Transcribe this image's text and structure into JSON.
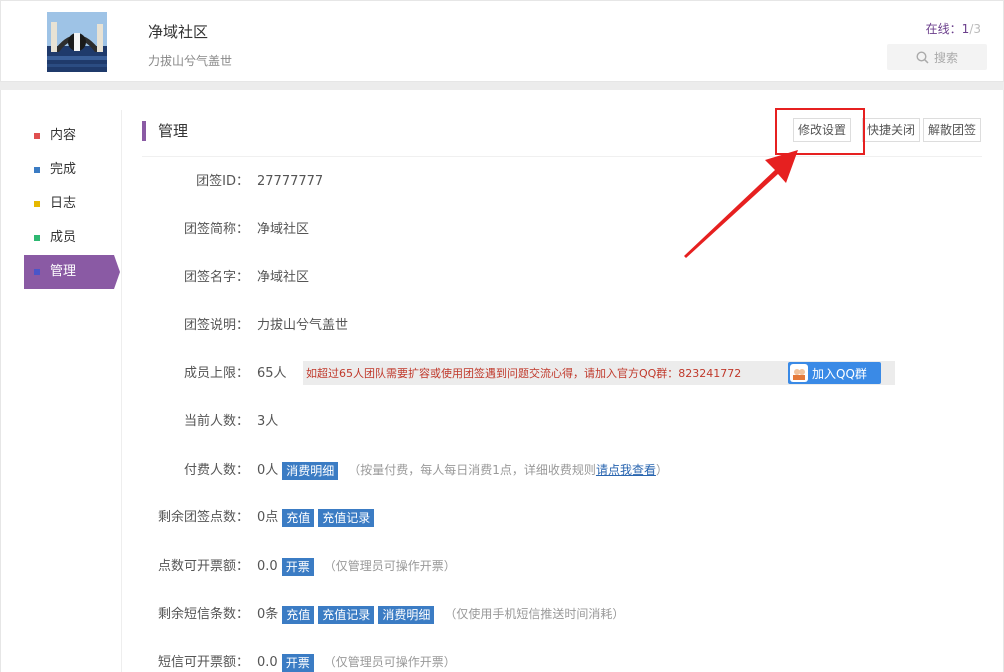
{
  "header": {
    "team_name": "净域社区",
    "team_slogan": "力拔山兮气盖世",
    "online_label": "在线：",
    "online_current": "1",
    "online_sep": "/",
    "online_total": "3",
    "search_label": "搜索"
  },
  "sidebar": {
    "items": [
      {
        "label": "内容",
        "color": "#e05050"
      },
      {
        "label": "完成",
        "color": "#3b7cc4"
      },
      {
        "label": "日志",
        "color": "#e6b800"
      },
      {
        "label": "成员",
        "color": "#2eb872"
      },
      {
        "label": "管理",
        "color": "#4a55c8"
      }
    ]
  },
  "section": {
    "title": "管理",
    "buttons": {
      "edit": "修改设置",
      "quick_close": "快捷关闭",
      "dissolve": "解散团签"
    }
  },
  "fields": {
    "id": {
      "label": "团签ID：",
      "value": "27777777"
    },
    "short_name": {
      "label": "团签简称：",
      "value": "净域社区"
    },
    "name": {
      "label": "团签名字：",
      "value": "净域社区"
    },
    "desc": {
      "label": "团签说明：",
      "value": "力拔山兮气盖世"
    },
    "limit": {
      "label": "成员上限：",
      "value": "65人",
      "notice": "如超过65人团队需要扩容或使用团签遇到问题交流心得，请加入官方QQ群：823241772",
      "qq_button": "加入QQ群"
    },
    "current": {
      "label": "当前人数：",
      "value": "3人"
    },
    "paying": {
      "label": "付费人数：",
      "value": "0人",
      "tag": "消费明细",
      "note_open": "（按量付费，每人每日消费1点，详细收费规则",
      "note_link": "请点我查看",
      "note_close": "）"
    },
    "points": {
      "label": "剩余团签点数：",
      "value": "0点",
      "tag1": "充值",
      "tag2": "充值记录"
    },
    "invoice_points": {
      "label": "点数可开票额：",
      "value": "0.0",
      "tag": "开票",
      "note": "（仅管理员可操作开票）"
    },
    "sms": {
      "label": "剩余短信条数：",
      "value": "0条",
      "tag1": "充值",
      "tag2": "充值记录",
      "tag3": "消费明细",
      "note": "（仅使用手机短信推送时间消耗）"
    },
    "invoice_sms": {
      "label": "短信可开票额：",
      "value": "0.0",
      "tag": "开票",
      "note": "（仅管理员可操作开票）"
    }
  },
  "colors": {
    "accent": "#8a5aa4",
    "tag_blue": "#3b7cc4",
    "highlight_red": "#e62020"
  }
}
